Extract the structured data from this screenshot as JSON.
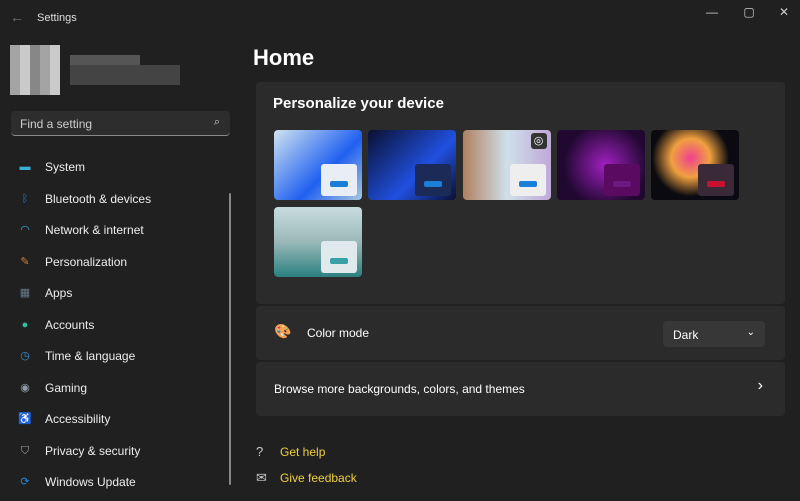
{
  "window": {
    "title": "Settings",
    "back": "←",
    "minimize": "—",
    "maximize": "▢",
    "close": "✕"
  },
  "search": {
    "placeholder": "Find a setting",
    "icon": "⌕"
  },
  "nav": [
    {
      "label": "System",
      "icon": "▬",
      "color": "#3ab0d8"
    },
    {
      "label": "Bluetooth & devices",
      "icon": "ᛒ",
      "color": "#1e7fe0"
    },
    {
      "label": "Network & internet",
      "icon": "◠",
      "color": "#3aa8e8"
    },
    {
      "label": "Personalization",
      "icon": "✎",
      "color": "#d08040"
    },
    {
      "label": "Apps",
      "icon": "▦",
      "color": "#6a7a90"
    },
    {
      "label": "Accounts",
      "icon": "●",
      "color": "#2cc0a0"
    },
    {
      "label": "Time & language",
      "icon": "◷",
      "color": "#3a9ad8"
    },
    {
      "label": "Gaming",
      "icon": "◉",
      "color": "#909aa8"
    },
    {
      "label": "Accessibility",
      "icon": "♿",
      "color": "#2a90e0"
    },
    {
      "label": "Privacy & security",
      "icon": "⛉",
      "color": "#9aa0a8"
    },
    {
      "label": "Windows Update",
      "icon": "⟳",
      "color": "#1e88e0"
    }
  ],
  "page": {
    "title": "Home"
  },
  "personalize": {
    "title": "Personalize your device"
  },
  "themes": [
    {
      "bg": "linear-gradient(135deg,#cfe3f0,#2060f0 60%,#a8c8e0)",
      "win": "#e8eef4",
      "bar": "#1a7fd8"
    },
    {
      "bg": "linear-gradient(135deg,#0a1030,#2050e0 60%,#0a1030)",
      "win": "#1c2a58",
      "bar": "#1a7fd8"
    },
    {
      "bg": "linear-gradient(90deg,#b08060,#cfe0ea 50%,#c0a8d8)",
      "win": "#eeeeee",
      "bar": "#1a7fd8"
    },
    {
      "bg": "radial-gradient(circle at 55% 50%,#a020c0,#200830 70%)",
      "win": "#5a0a60",
      "bar": "#6a1a80"
    },
    {
      "bg": "radial-gradient(circle at 45% 40%,#f04090,#f0a040 30%,#0a0a10 60%)",
      "win": "#3a2a38",
      "bar": "#c81030"
    },
    {
      "bg": "linear-gradient(180deg,#c8dce0,#9ab8b8 50%,#2a8080)",
      "win": "#e0eaec",
      "bar": "#3aa0a8"
    }
  ],
  "color_mode": {
    "label": "Color mode",
    "value": "Dark",
    "icon": "🎨"
  },
  "browse": {
    "label": "Browse more backgrounds, colors, and themes",
    "chevron": "›"
  },
  "links": [
    {
      "label": "Get help",
      "icon": "?"
    },
    {
      "label": "Give feedback",
      "icon": "✉"
    }
  ]
}
